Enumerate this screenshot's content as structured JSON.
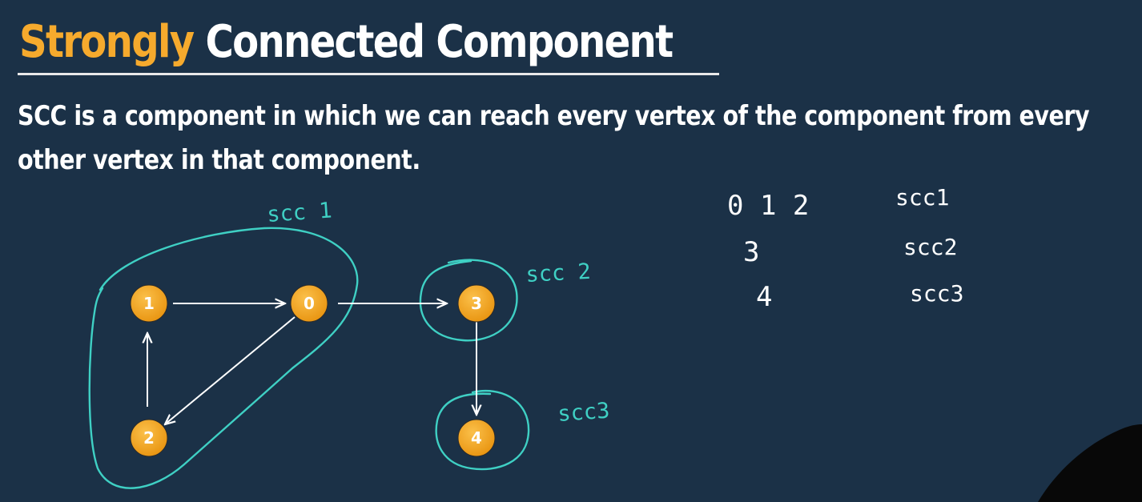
{
  "title": {
    "accent": "Strongly",
    "rest": "Connected Component"
  },
  "description": {
    "line1": "SCC is a component in which we can reach every vertex of the component from every",
    "line2": "other vertex in that component."
  },
  "graph": {
    "nodes": [
      "1",
      "0",
      "3",
      "2",
      "4"
    ],
    "edges": [
      {
        "from": "1",
        "to": "0"
      },
      {
        "from": "0",
        "to": "3"
      },
      {
        "from": "3",
        "to": "4"
      },
      {
        "from": "0",
        "to": "2"
      },
      {
        "from": "2",
        "to": "1"
      }
    ],
    "annotations": {
      "scc1": "scc 1",
      "scc2": "scc 2",
      "scc3": "scc3"
    }
  },
  "notes": {
    "rows": [
      {
        "vertices": "0 1 2",
        "label": "scc1"
      },
      {
        "vertices": "3",
        "label": "scc2"
      },
      {
        "vertices": "4",
        "label": "scc3"
      }
    ]
  },
  "colors": {
    "background": "#1b3147",
    "title_accent": "#f6aa2d",
    "node_fill": "#f3a21c",
    "annotation": "#3fd0c4"
  }
}
